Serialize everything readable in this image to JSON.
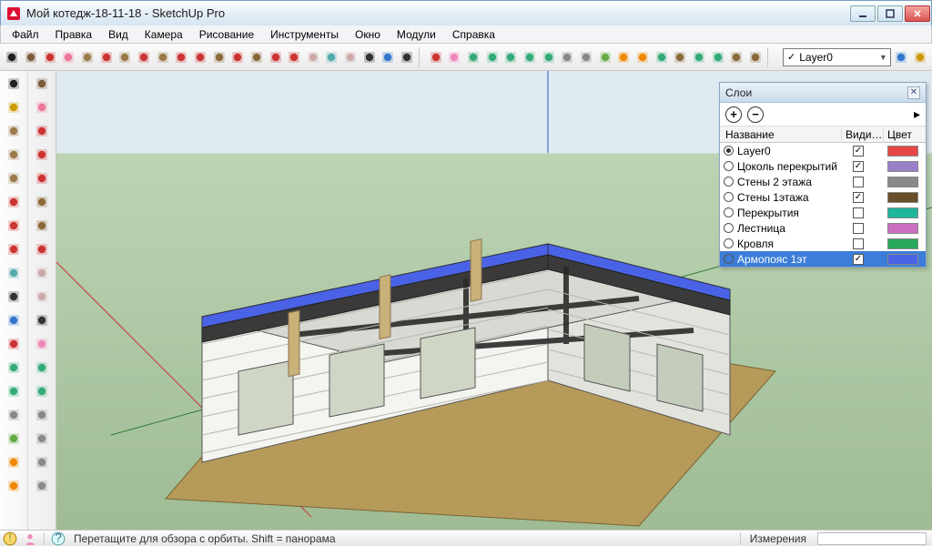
{
  "title": "Мой котедж-18-11-18 - SketchUp Pro",
  "menu": {
    "items": [
      "Файл",
      "Правка",
      "Вид",
      "Камера",
      "Рисование",
      "Инструменты",
      "Окно",
      "Модули",
      "Справка"
    ]
  },
  "layer_selector": {
    "value": "Layer0"
  },
  "layers_panel": {
    "title": "Слои",
    "add_symbol": "+",
    "remove_symbol": "−",
    "columns": {
      "name": "Название",
      "visible": "Види…",
      "color": "Цвет"
    },
    "rows": [
      {
        "name": "Layer0",
        "active": true,
        "visible": true,
        "color": "#e64646",
        "selected": false
      },
      {
        "name": "Цоколь перекрытий",
        "active": false,
        "visible": true,
        "color": "#9a7fc9",
        "selected": false
      },
      {
        "name": "Стены 2 этажа",
        "active": false,
        "visible": false,
        "color": "#8a8a8a",
        "selected": false
      },
      {
        "name": "Стены 1этажа",
        "active": false,
        "visible": true,
        "color": "#6a4e2a",
        "selected": false
      },
      {
        "name": "Перекрытия",
        "active": false,
        "visible": false,
        "color": "#1fb59b",
        "selected": false
      },
      {
        "name": "Лестница",
        "active": false,
        "visible": false,
        "color": "#cc6fc1",
        "selected": false
      },
      {
        "name": "Кровля",
        "active": false,
        "visible": false,
        "color": "#2aa85d",
        "selected": false
      },
      {
        "name": "Армопояс 1эт",
        "active": false,
        "visible": true,
        "color": "#4a62e6",
        "selected": true
      }
    ]
  },
  "status": {
    "hint": "Перетащите для обзора с орбиты.  Shift = панорама",
    "measure_label": "Измерения"
  },
  "top_tools": [
    {
      "n": "select-tool",
      "c": "#222"
    },
    {
      "n": "make-component",
      "c": "#7a5c3a"
    },
    {
      "n": "paint-bucket",
      "c": "#c33"
    },
    {
      "n": "eraser",
      "c": "#e79"
    },
    {
      "n": "rectangle",
      "c": "#9a7a4a"
    },
    {
      "n": "line",
      "c": "#c33"
    },
    {
      "n": "circle",
      "c": "#9a7a4a"
    },
    {
      "n": "arc",
      "c": "#c33"
    },
    {
      "n": "polygon",
      "c": "#9a7a4a"
    },
    {
      "n": "freehand",
      "c": "#c33"
    },
    {
      "n": "move",
      "c": "#c33"
    },
    {
      "n": "pushpull",
      "c": "#8a6a3a"
    },
    {
      "n": "rotate",
      "c": "#c33"
    },
    {
      "n": "followme",
      "c": "#8a6a3a"
    },
    {
      "n": "scale",
      "c": "#c33"
    },
    {
      "n": "offset",
      "c": "#c33"
    },
    {
      "n": "tape",
      "c": "#caa"
    },
    {
      "n": "dimension",
      "c": "#5aa"
    },
    {
      "n": "protractor",
      "c": "#caa"
    },
    {
      "n": "text",
      "c": "#333"
    },
    {
      "n": "axes",
      "c": "#37c"
    },
    {
      "n": "3dtext",
      "c": "#333"
    }
  ],
  "top_tools2": [
    {
      "n": "orbit",
      "c": "#c33"
    },
    {
      "n": "pan",
      "c": "#e8b"
    },
    {
      "n": "zoom",
      "c": "#3a7"
    },
    {
      "n": "zoom-window",
      "c": "#3a7"
    },
    {
      "n": "previous",
      "c": "#3a7"
    },
    {
      "n": "next",
      "c": "#3a7"
    },
    {
      "n": "zoom-extents",
      "c": "#3a7"
    },
    {
      "n": "position-camera",
      "c": "#888"
    },
    {
      "n": "look-around",
      "c": "#888"
    },
    {
      "n": "walk",
      "c": "#6a4"
    },
    {
      "n": "section",
      "c": "#e80"
    },
    {
      "n": "section-display",
      "c": "#e80"
    },
    {
      "n": "google-earth",
      "c": "#3a7"
    },
    {
      "n": "ge-export",
      "c": "#8a6a3a"
    },
    {
      "n": "ge-terrain",
      "c": "#3a7"
    },
    {
      "n": "ge-place",
      "c": "#3a7"
    },
    {
      "n": "share",
      "c": "#8a6a3a"
    },
    {
      "n": "3dwarehouse",
      "c": "#8a6a3a"
    }
  ],
  "end_tools": [
    {
      "n": "layer-query",
      "c": "#37c"
    },
    {
      "n": "layer-manager",
      "c": "#c90"
    }
  ],
  "left_col_a": [
    {
      "n": "select",
      "c": "#222"
    },
    {
      "n": "paint",
      "c": "#c90"
    },
    {
      "n": "rectangle",
      "c": "#9a7a4a"
    },
    {
      "n": "circle",
      "c": "#9a7a4a"
    },
    {
      "n": "polygon",
      "c": "#9a7a4a"
    },
    {
      "n": "move",
      "c": "#c33"
    },
    {
      "n": "rotate",
      "c": "#c33"
    },
    {
      "n": "offset",
      "c": "#c33"
    },
    {
      "n": "dimension",
      "c": "#5aa"
    },
    {
      "n": "text",
      "c": "#333"
    },
    {
      "n": "axes",
      "c": "#37c"
    },
    {
      "n": "orbit",
      "c": "#c33"
    },
    {
      "n": "zoom",
      "c": "#3a7"
    },
    {
      "n": "prev-view",
      "c": "#3a7"
    },
    {
      "n": "position-camera",
      "c": "#888"
    },
    {
      "n": "walk",
      "c": "#6a4"
    },
    {
      "n": "section-plane",
      "c": "#e80"
    },
    {
      "n": "section-fill",
      "c": "#e80"
    }
  ],
  "left_col_b": [
    {
      "n": "component",
      "c": "#7a5c3a"
    },
    {
      "n": "eraser",
      "c": "#e79"
    },
    {
      "n": "line",
      "c": "#c33"
    },
    {
      "n": "arc",
      "c": "#c33"
    },
    {
      "n": "freehand",
      "c": "#c33"
    },
    {
      "n": "pushpull",
      "c": "#8a6a3a"
    },
    {
      "n": "followme",
      "c": "#8a6a3a"
    },
    {
      "n": "scale",
      "c": "#c33"
    },
    {
      "n": "tape",
      "c": "#caa"
    },
    {
      "n": "protractor",
      "c": "#caa"
    },
    {
      "n": "3dtext",
      "c": "#333"
    },
    {
      "n": "pan",
      "c": "#e8b"
    },
    {
      "n": "zoom-window",
      "c": "#3a7"
    },
    {
      "n": "next-view",
      "c": "#3a7"
    },
    {
      "n": "look-around",
      "c": "#888"
    },
    {
      "n": "xray",
      "c": "#888"
    },
    {
      "n": "shadows",
      "c": "#888"
    },
    {
      "n": "eye",
      "c": "#888"
    }
  ]
}
